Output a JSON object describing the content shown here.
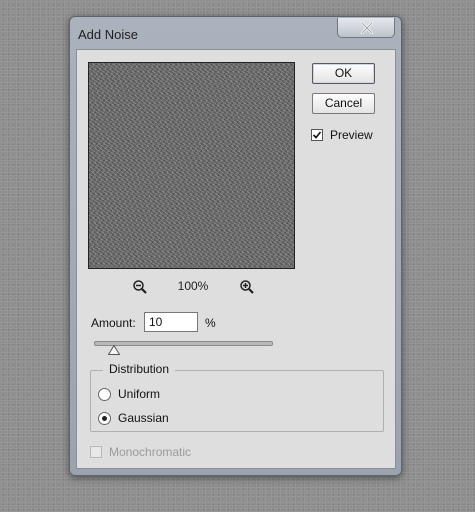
{
  "dialog": {
    "title": "Add Noise",
    "close_icon": "close-x-icon"
  },
  "preview": {
    "zoom_level": "100%",
    "zoom_out_icon": "zoom-out-icon",
    "zoom_in_icon": "zoom-in-icon"
  },
  "buttons": {
    "ok_label": "OK",
    "cancel_label": "Cancel"
  },
  "preview_option": {
    "label": "Preview",
    "checked": true
  },
  "amount": {
    "label": "Amount:",
    "value": "10",
    "unit": "%",
    "slider_fraction": 0.1
  },
  "distribution": {
    "title": "Distribution",
    "options": [
      {
        "label": "Uniform",
        "selected": false
      },
      {
        "label": "Gaussian",
        "selected": true
      }
    ]
  },
  "monochromatic": {
    "label": "Monochromatic",
    "checked": false,
    "enabled": false
  }
}
